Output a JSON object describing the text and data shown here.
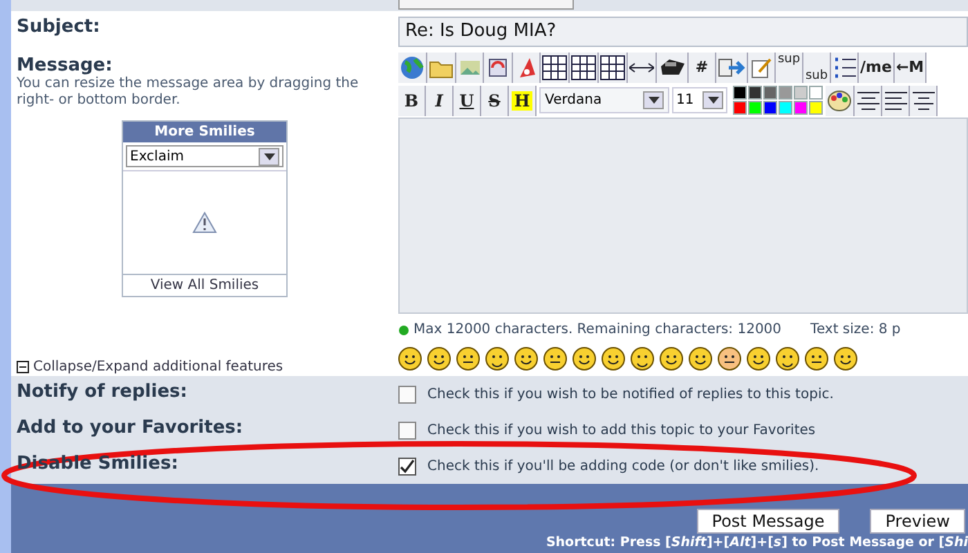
{
  "subject": {
    "label": "Subject:",
    "value": "Re: Is Doug MIA?"
  },
  "message": {
    "label": "Message:",
    "help": "You can resize the message area by dragging the right- or bottom border."
  },
  "more_smilies": {
    "title": "More Smilies",
    "category": "Exclaim",
    "link": "View All Smilies"
  },
  "toolbar_row1_texts": [
    "#",
    "sup",
    "sub",
    "/me",
    "←M"
  ],
  "format_buttons": [
    "B",
    "I",
    "U",
    "S",
    "H"
  ],
  "font": "Verdana",
  "size": "11",
  "colors": [
    {
      "color": "#000000"
    },
    {
      "color": "#333333"
    },
    {
      "color": "#666666"
    },
    {
      "color": "#999999"
    },
    {
      "color": "#cccccc"
    },
    {
      "color": "#ffffff"
    },
    {
      "color": "#ff0000"
    },
    {
      "color": "#00ff00"
    },
    {
      "color": "#0000ff"
    },
    {
      "color": "#00ffff"
    },
    {
      "color": "#ff00ff"
    },
    {
      "color": "#ffff00"
    }
  ],
  "counter": "Max 12000 characters. Remaining characters:  12000",
  "text_size": "Text size:  8  p",
  "collapse": "Collapse/Expand additional features",
  "options": [
    {
      "label": "Notify of replies:",
      "text": "Check this if you wish to be notified of replies to this topic.",
      "checked": false
    },
    {
      "label": "Add to your Favorites:",
      "text": "Check this if you wish to add this topic to your Favorites",
      "checked": false
    },
    {
      "label": "Disable Smilies:",
      "text": "Check this if you'll be adding code (or don't like smilies).",
      "checked": true
    }
  ],
  "buttons": [
    "Post Message",
    "Preview"
  ],
  "shortcut": "Shortcut: Press [*Shift*]+[*Alt*]+[*s*] to Post Message or [*Shi*"
}
